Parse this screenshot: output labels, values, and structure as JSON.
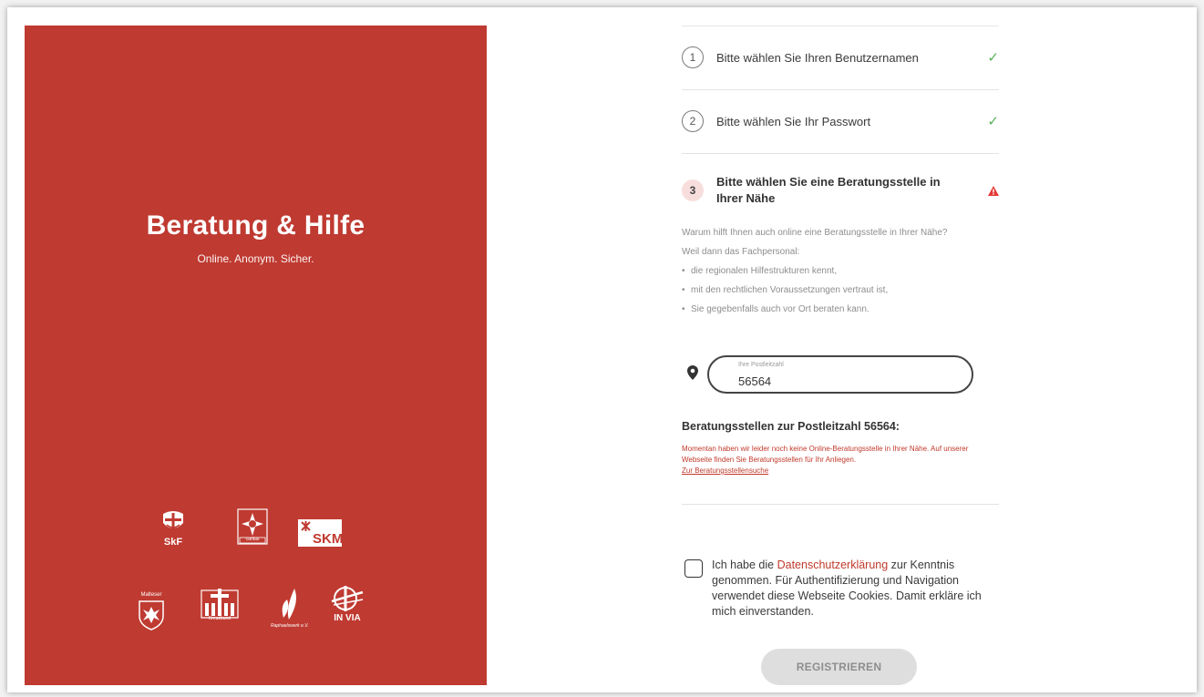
{
  "brand": {
    "title": "Beratung & Hilfe",
    "subtitle": "Online. Anonym. Sicher.",
    "background": "#bf3a31",
    "logos": [
      {
        "name": "skf",
        "caption": "SkF"
      },
      {
        "name": "caritas",
        "caption": "caritas"
      },
      {
        "name": "skm",
        "caption": "SKM"
      },
      {
        "name": "malteser",
        "caption": "Malteser"
      },
      {
        "name": "kreuzbund",
        "caption": "Kreuzbund"
      },
      {
        "name": "raphaelswerk",
        "caption": "Raphaelswerk e.V."
      },
      {
        "name": "invia",
        "caption": "IN VIA"
      }
    ]
  },
  "steps": [
    {
      "number": "1",
      "label": "Bitte wählen Sie Ihren Benutzernamen",
      "status_icon": "check-icon",
      "status_glyph": "✓"
    },
    {
      "number": "2",
      "label": "Bitte wählen Sie Ihr Passwort",
      "status_icon": "check-icon",
      "status_glyph": "✓"
    },
    {
      "number": "3",
      "label": "Bitte wählen Sie eine Beratungsstelle in Ihrer Nähe",
      "status_icon": "warning-icon"
    }
  ],
  "info": {
    "question": "Warum hilft Ihnen auch online eine Beratungsstelle in Ihrer Nähe?",
    "intro": "Weil dann das Fachpersonal:",
    "bullets": [
      "die regionalen Hilfestrukturen kennt,",
      "mit den rechtlichen Voraussetzungen vertraut ist,",
      "Sie gegebenfalls auch vor Ort beraten kann."
    ]
  },
  "postcode": {
    "label": "Ihre Postleitzahl",
    "value": "56564",
    "icon": "map-pin-icon"
  },
  "results": {
    "title": "Beratungsstellen zur Postleitzahl 56564:",
    "message": "Momentan haben wir leider noch keine Online-Beratungsstelle in Ihrer Nähe. Auf unserer Webseite finden Sie Beratungsstellen für Ihr Anliegen.",
    "link": "Zur Beratungsstellensuche"
  },
  "consent": {
    "prefix": "Ich habe die ",
    "link": "Datenschutzerklärung",
    "suffix": " zur Kenntnis genommen. Für Authentifizierung und Navigation verwendet diese Webseite Cookies. Damit erkläre ich mich einverstanden."
  },
  "register_button": "REGISTRIEREN",
  "colors": {
    "accent": "#c0392b",
    "success": "#5bb15b",
    "warning": "#e53935",
    "disabled_button": "#dedede"
  }
}
